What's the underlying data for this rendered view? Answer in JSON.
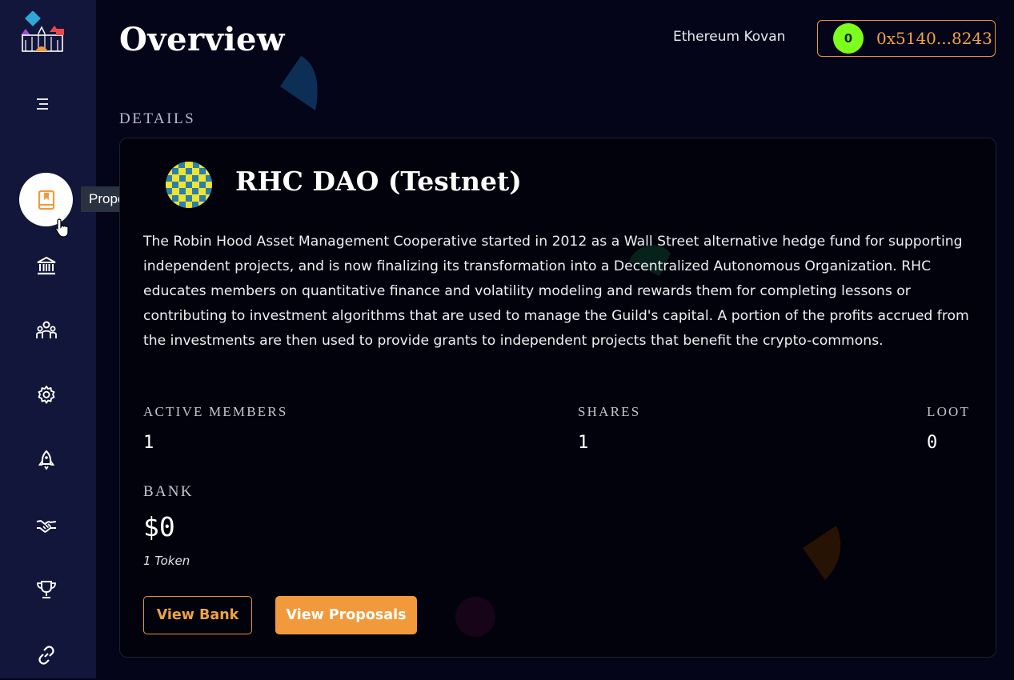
{
  "sidebar": {
    "items": [
      {
        "name": "proposals",
        "icon": "book-icon",
        "tooltip": "Proposals",
        "active": true
      },
      {
        "name": "bank",
        "icon": "bank-icon"
      },
      {
        "name": "members",
        "icon": "users-icon"
      },
      {
        "name": "settings",
        "icon": "gear-icon"
      },
      {
        "name": "notifications",
        "icon": "bell-rocket-icon"
      },
      {
        "name": "allies",
        "icon": "handshake-icon"
      },
      {
        "name": "boosts",
        "icon": "trophy-icon"
      },
      {
        "name": "links",
        "icon": "link-icon"
      }
    ],
    "tooltip": "Proposals"
  },
  "header": {
    "title": "Overview",
    "network": "Ethereum Kovan",
    "account_badge": "0",
    "account_address": "0x5140...8243"
  },
  "details": {
    "section_label": "DETAILS",
    "dao_name": "RHC DAO (Testnet)",
    "description": "The Robin Hood Asset Management Cooperative started in 2012 as a Wall Street alternative hedge fund for supporting independent projects, and is now finalizing its transformation into a Decentralized Autonomous Organization. RHC educates members on quantitative finance and volatility modeling and rewards them for completing lessons or contributing to investment algorithms that are used to manage the Guild's capital. A portion of the profits accrued from the investments are then used to provide grants to independent projects that benefit the crypto-commons.",
    "stats": {
      "active_members_label": "ACTIVE MEMBERS",
      "active_members_value": "1",
      "shares_label": "SHARES",
      "shares_value": "1",
      "loot_label": "LOOT",
      "loot_value": "0"
    },
    "bank": {
      "label": "BANK",
      "value": "$0",
      "tokens": "1 Token"
    },
    "buttons": {
      "view_bank": "View Bank",
      "view_proposals": "View Proposals"
    }
  },
  "colors": {
    "accent": "#f29a3b",
    "sidebar": "#12163b",
    "background": "#05051a",
    "badge": "#7cff1c"
  }
}
